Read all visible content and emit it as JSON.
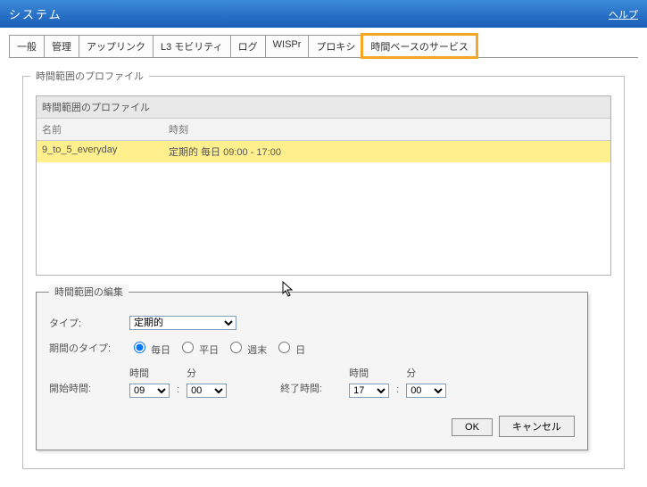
{
  "header": {
    "title": "システム",
    "help": "ヘルプ"
  },
  "tabs": [
    "一般",
    "管理",
    "アップリンク",
    "L3 モビリティ",
    "ログ",
    "WISPr",
    "プロキシ",
    "時間ベースのサービス"
  ],
  "active_tab_index": 7,
  "profile_section": {
    "legend": "時間範囲のプロファイル",
    "list_title": "時間範囲のプロファイル",
    "columns": {
      "name": "名前",
      "time": "時刻"
    },
    "rows": [
      {
        "name": "9_to_5_everyday",
        "time": "定期的 毎日 09:00 - 17:00"
      }
    ]
  },
  "edit_section": {
    "legend": "時間範囲の編集",
    "type_label": "タイプ:",
    "type_value": "定期的",
    "period_label": "期間のタイプ:",
    "period_options": {
      "daily": "毎日",
      "weekday": "平日",
      "weekend": "週末",
      "day": "日"
    },
    "start_label": "開始時間:",
    "end_label": "終了時間:",
    "hour_header": "時間",
    "minute_header": "分",
    "start_hour": "09",
    "start_min": "00",
    "end_hour": "17",
    "end_min": "00",
    "ok": "OK",
    "cancel": "キャンセル"
  }
}
